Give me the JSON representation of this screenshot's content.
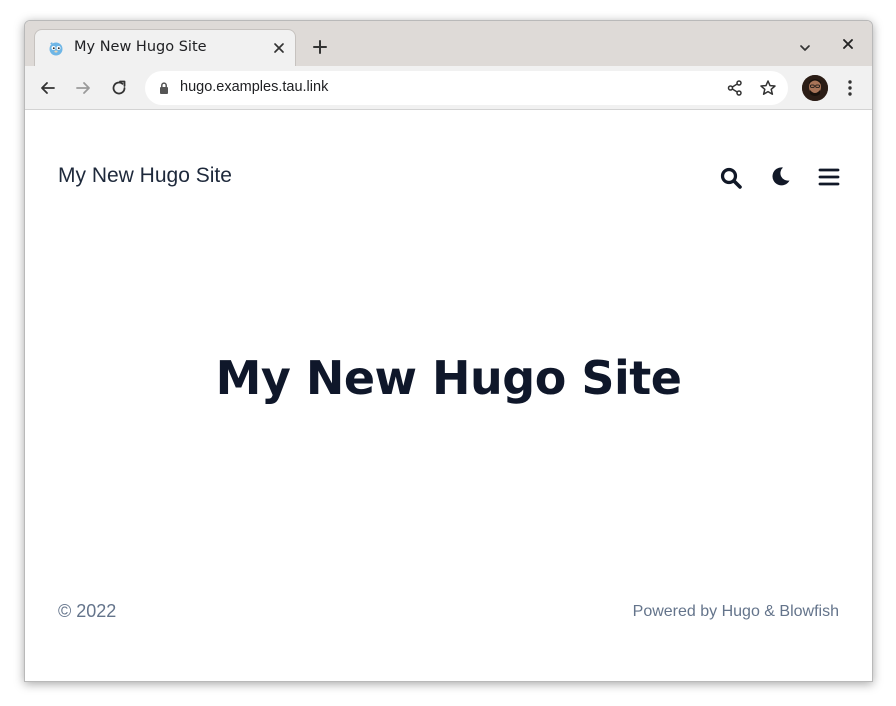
{
  "browser": {
    "tab": {
      "title": "My New Hugo Site",
      "favicon": "hugo-gopher-icon"
    },
    "address": {
      "url": "hugo.examples.tau.link"
    },
    "icons": {
      "back": "back-arrow-icon",
      "forward": "forward-arrow-icon",
      "reload": "reload-icon",
      "share": "share-icon",
      "bookmark": "star-icon",
      "menu": "kebab-menu-icon"
    }
  },
  "site": {
    "logo": "My New Hugo Site",
    "hero_title": "My New Hugo Site",
    "header_icons": [
      "search-icon",
      "moon-icon",
      "hamburger-menu-icon"
    ]
  },
  "footer": {
    "copyright": "© 2022",
    "powered_prefix": "Powered by",
    "powered_hugo": "Hugo",
    "powered_amp": "&",
    "powered_blowfish": "Blowfish"
  },
  "colors": {
    "text_dark": "#0f172a",
    "text_muted": "#64748b",
    "chrome_tabstrip": "#dedad7",
    "chrome_toolbar": "#f1f1f1"
  }
}
